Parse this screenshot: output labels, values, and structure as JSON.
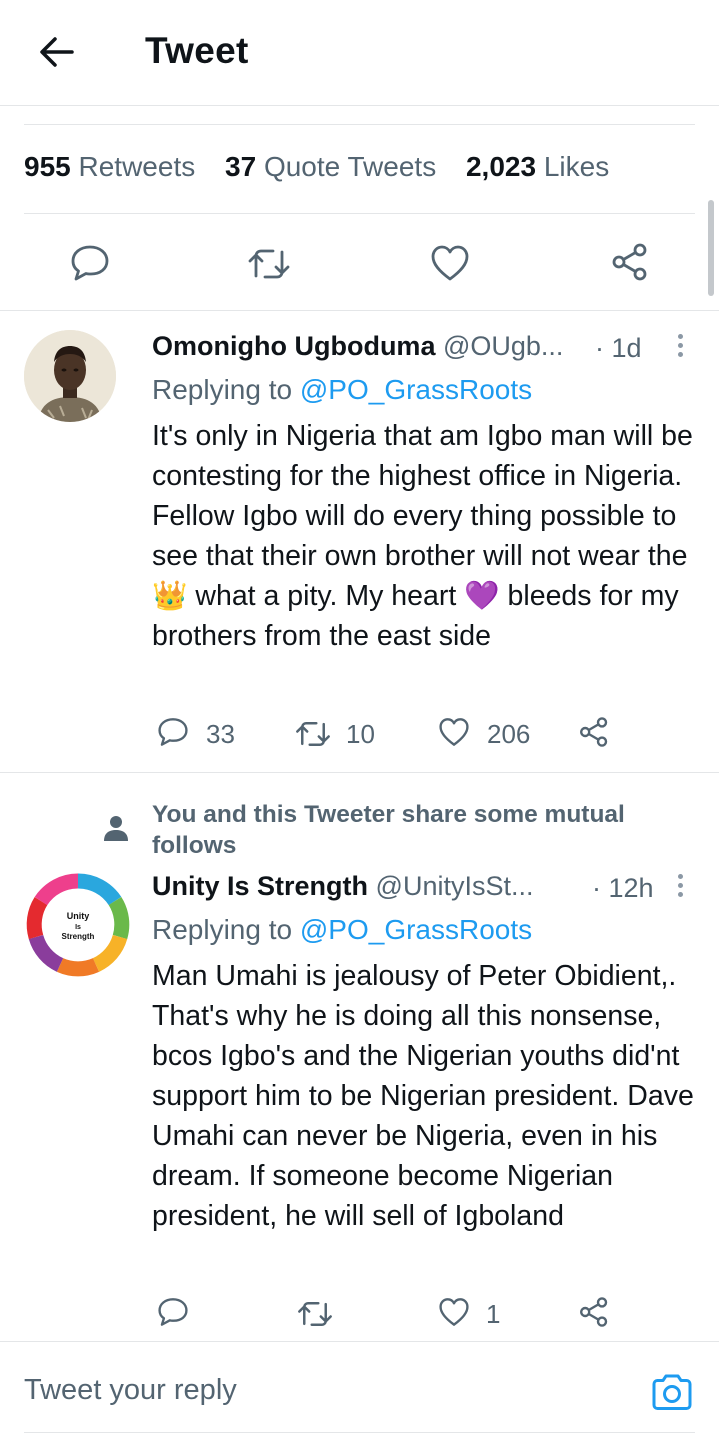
{
  "header": {
    "title": "Tweet",
    "back_icon": "arrow-left-icon"
  },
  "stats": [
    {
      "value": "955",
      "label": "Retweets"
    },
    {
      "value": "37",
      "label": "Quote Tweets"
    },
    {
      "value": "2,023",
      "label": "Likes"
    }
  ],
  "colors": {
    "accent": "#1d9bf0",
    "muted": "#536471",
    "text": "#0f1419",
    "divider": "#e4e6e8"
  },
  "replies": [
    {
      "name": "Omonigho Ugboduma",
      "handle": "@OUgb...",
      "time": "· 1d",
      "replying_prefix": "Replying to",
      "replying_to": "@PO_GrassRoots",
      "text": "It's only in Nigeria that am Igbo man will be contesting for the highest office in Nigeria. Fellow Igbo will do every thing possible to see that their own brother will not wear the 👑 what a pity. My heart 💜 bleeds for my brothers from the east side",
      "reply_count": "33",
      "retweet_count": "10",
      "like_count": "206"
    },
    {
      "context": "You and this Tweeter share some mutual follows",
      "name": "Unity Is Strength",
      "handle": "@UnityIsSt...",
      "time": "· 12h",
      "replying_prefix": "Replying to",
      "replying_to": "@PO_GrassRoots",
      "text": "Man Umahi is jealousy of Peter Obidient,. That's why he is doing all this nonsense, bcos Igbo's and the Nigerian youths did'nt support him to be Nigerian president. Dave Umahi can never be Nigeria, even in his dream. If someone become Nigerian president, he will sell of Igboland",
      "reply_count": "",
      "retweet_count": "",
      "like_count": "1",
      "avatar_text": [
        "Unity",
        "Is",
        "Strength"
      ]
    }
  ],
  "composer": {
    "placeholder": "Tweet your reply",
    "camera_icon": "camera-icon"
  }
}
